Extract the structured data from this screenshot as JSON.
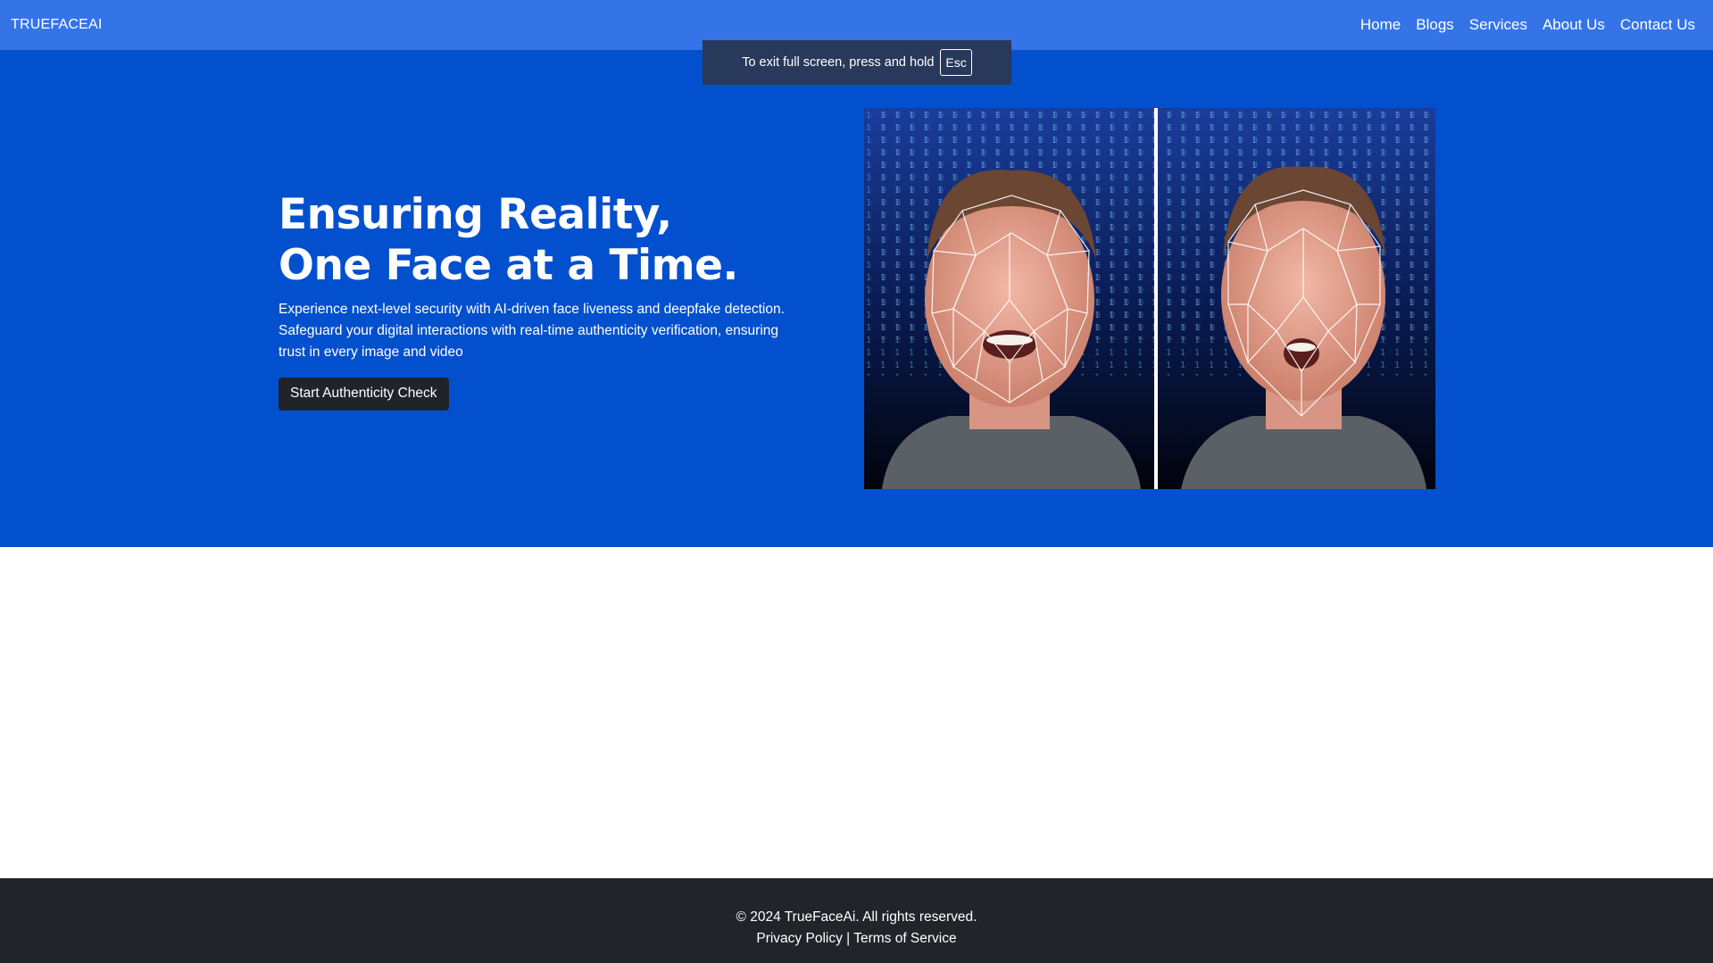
{
  "nav": {
    "brand": "TRUEFACEAI",
    "links": [
      "Home",
      "Blogs",
      "Services",
      "About Us",
      "Contact Us"
    ]
  },
  "fullscreen_notice": {
    "text": "To exit full screen, press and hold",
    "key": "Esc"
  },
  "hero": {
    "title_line1": "Ensuring Reality,",
    "title_line2": "One Face at a Time.",
    "description": "Experience next-level security with AI-driven face liveness and deepfake detection. Safeguard your digital interactions with real-time authenticity verification, ensuring trust in every image and video",
    "cta_label": "Start Authenticity Check"
  },
  "footer": {
    "copyright": "© 2024 TrueFaceAi. All rights reserved.",
    "privacy": "Privacy Policy",
    "separator": "|",
    "terms": "Terms of Service"
  },
  "colors": {
    "navbar": "#3574e6",
    "hero": "#0250cd",
    "button": "#20232a",
    "footer": "#212429"
  }
}
